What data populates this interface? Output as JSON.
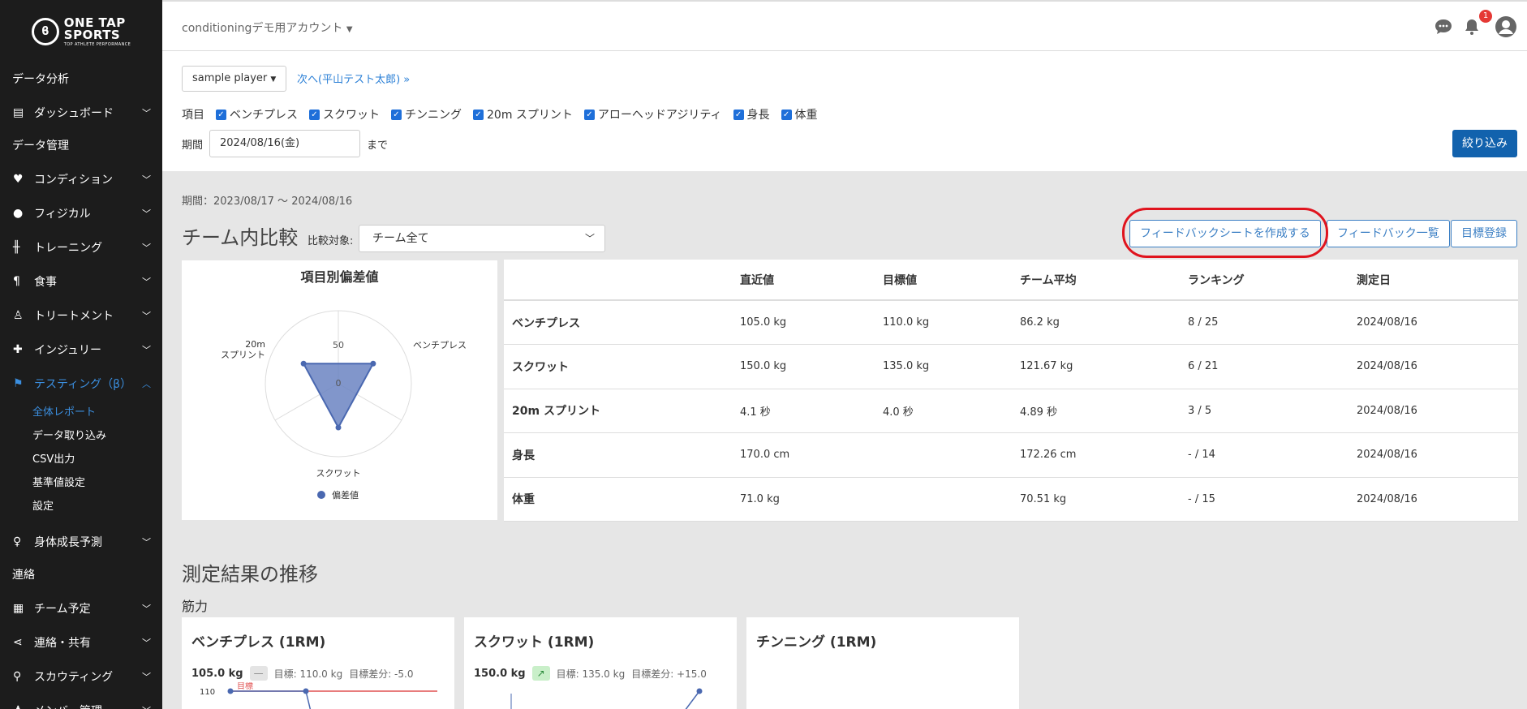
{
  "brand": {
    "line1": "ONE TAP",
    "line2": "SPORTS",
    "line3": "TOP ATHLETE PERFORMANCE"
  },
  "account": {
    "name": "conditioningデモ用アカウント"
  },
  "notifications": {
    "count": "1"
  },
  "sidebar": {
    "section_analysis": "データ分析",
    "dashboard": "ダッシュボード",
    "section_data": "データ管理",
    "condition": "コンディション",
    "physical": "フィジカル",
    "training": "トレーニング",
    "meal": "食事",
    "treatment": "トリートメント",
    "injury": "インジュリー",
    "testing": "テスティング（β）",
    "testing_sub": [
      "全体レポート",
      "データ取り込み",
      "CSV出力",
      "基準値設定",
      "設定"
    ],
    "growth": "身体成長予測",
    "section_contact": "連絡",
    "schedule": "チーム予定",
    "share": "連絡・共有",
    "scouting": "スカウティング",
    "member": "メンバー管理"
  },
  "filter": {
    "player": "sample player",
    "next_link": "次へ(平山テスト太郎) »",
    "items_label": "項目",
    "items": [
      "ベンチプレス",
      "スクワット",
      "チンニング",
      "20m スプリント",
      "アローヘッドアジリティ",
      "身長",
      "体重"
    ],
    "period_label": "期間",
    "period_value": "2024/08/16(金)",
    "until": "まで",
    "button": "絞り込み"
  },
  "main": {
    "period_text": "期間：2023/08/17 〜 2024/08/16",
    "section_title": "チーム内比較",
    "compare_label": "比較対象:",
    "compare_value": "チーム全て",
    "btn_create_feedback": "フィードバックシートを作成する",
    "btn_feedback_list": "フィードバック一覧",
    "btn_goal": "目標登録"
  },
  "radar": {
    "title": "項目別偏差値",
    "label_bench": "ベンチプレス",
    "label_squat": "スクワット",
    "label_sprint_l1": "20m",
    "label_sprint_l2": "スプリント",
    "tick_50": "50",
    "tick_0": "0",
    "legend": "偏差値"
  },
  "chart_data": {
    "type": "radar",
    "title": "項目別偏差値",
    "axes": [
      "ベンチプレス",
      "スクワット",
      "20m スプリント"
    ],
    "series": [
      {
        "name": "偏差値",
        "values": [
          55,
          60,
          55
        ],
        "color": "#4a68b0"
      }
    ],
    "rlim": [
      0,
      100
    ],
    "ticks": [
      "0",
      "50"
    ],
    "legend": "bottom"
  },
  "table": {
    "headers": [
      "",
      "直近値",
      "目標値",
      "チーム平均",
      "ランキング",
      "測定日"
    ],
    "rows": [
      [
        "ベンチプレス",
        "105.0 kg",
        "110.0 kg",
        "86.2 kg",
        "8 / 25",
        "2024/08/16"
      ],
      [
        "スクワット",
        "150.0 kg",
        "135.0 kg",
        "121.67 kg",
        "6 / 21",
        "2024/08/16"
      ],
      [
        "20m スプリント",
        "4.1 秒",
        "4.0 秒",
        "4.89 秒",
        "3 / 5",
        "2024/08/16"
      ],
      [
        "身長",
        "170.0 cm",
        "",
        "172.26 cm",
        "- / 14",
        "2024/08/16"
      ],
      [
        "体重",
        "71.0 kg",
        "",
        "70.51 kg",
        "- / 15",
        "2024/08/16"
      ]
    ]
  },
  "trend": {
    "title": "測定結果の推移",
    "subtitle": "筋力",
    "cards": [
      {
        "title": "ベンチプレス (1RM)",
        "value": "105.0 kg",
        "indicator": "—",
        "goal": "目標: 110.0 kg",
        "diff": "目標差分: -5.0",
        "axis_top": "110",
        "goal_tag": "目標"
      },
      {
        "title": "スクワット (1RM)",
        "value": "150.0 kg",
        "indicator": "↗",
        "goal": "目標: 135.0 kg",
        "diff": "目標差分: +15.0"
      },
      {
        "title": "チンニング (1RM)"
      }
    ]
  },
  "colors": {
    "accent": "#1262ad",
    "sidebar_active": "#3b8fe0",
    "highlight": "#e0141e",
    "radar_fill": "#6b84c2"
  }
}
